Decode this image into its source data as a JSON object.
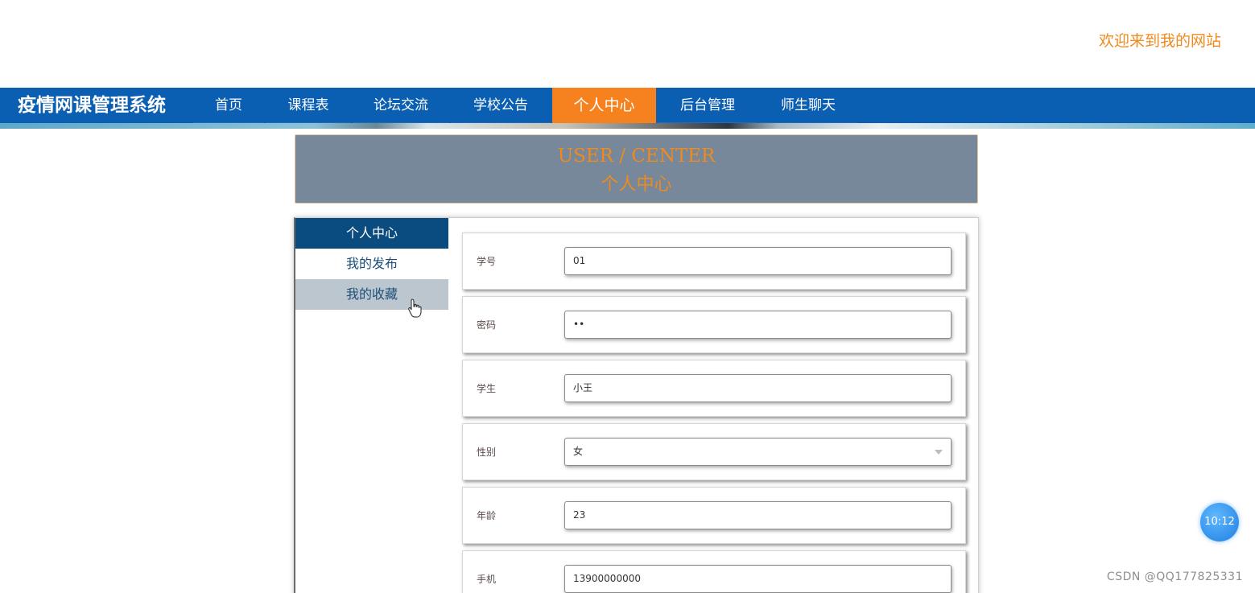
{
  "header": {
    "welcome": "欢迎来到我的网站"
  },
  "nav": {
    "brand": "疫情网课管理系统",
    "items": [
      {
        "label": "首页"
      },
      {
        "label": "课程表"
      },
      {
        "label": "论坛交流"
      },
      {
        "label": "学校公告"
      },
      {
        "label": "个人中心",
        "active": true
      },
      {
        "label": "后台管理"
      },
      {
        "label": "师生聊天"
      }
    ]
  },
  "banner": {
    "title_en": "USER / CENTER",
    "title_cn": "个人中心"
  },
  "sidebar": {
    "items": [
      {
        "label": "个人中心",
        "state": "active"
      },
      {
        "label": "我的发布",
        "state": "normal"
      },
      {
        "label": "我的收藏",
        "state": "hover"
      }
    ]
  },
  "form": {
    "fields": [
      {
        "label": "学号",
        "value": "01",
        "type": "text"
      },
      {
        "label": "密码",
        "value": "••",
        "type": "password"
      },
      {
        "label": "学生",
        "value": "小王",
        "type": "text"
      },
      {
        "label": "性别",
        "value": "女",
        "type": "select"
      },
      {
        "label": "年龄",
        "value": "23",
        "type": "text"
      },
      {
        "label": "手机",
        "value": "13900000000",
        "type": "text"
      }
    ]
  },
  "clock": {
    "time": "10:12"
  },
  "watermark": {
    "text": "CSDN @QQ177825331"
  },
  "colors": {
    "nav_bg": "#0a5fb3",
    "nav_active": "#f5821f",
    "accent_orange": "#f08a1e",
    "banner_bg": "#768899",
    "sidebar_active": "#0b4c80"
  }
}
